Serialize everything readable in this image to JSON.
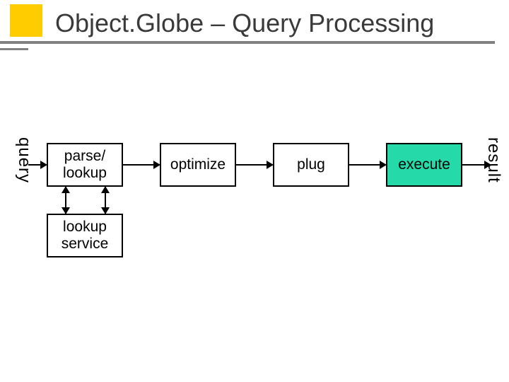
{
  "title": "Object.Globe – Query Processing",
  "labels": {
    "query": "query",
    "result": "result"
  },
  "boxes": {
    "parse_lookup": "parse/\nlookup",
    "optimize": "optimize",
    "plug": "plug",
    "execute": "execute",
    "lookup_service": "lookup\nservice"
  }
}
